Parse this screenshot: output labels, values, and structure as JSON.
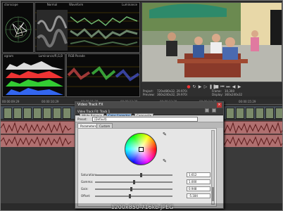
{
  "scopes": {
    "vectorscope": {
      "title": "ctorscope"
    },
    "waveform": {
      "title": "Waveform",
      "mode": "Normal",
      "mode2": "Luminance"
    },
    "histogram": {
      "title": "ogram",
      "mode": "Luminance/R,G,B"
    },
    "parade": {
      "title": "RGB Parade"
    }
  },
  "preview": {
    "project_label": "Project:",
    "project_value": "720x480x32, 29.970i",
    "preview_label": "Preview:",
    "preview_value": "360x240x32, 29.970i",
    "frame_label": "Frame:",
    "frame_value": "10,300",
    "display_label": "Display:",
    "display_value": "360x240x32"
  },
  "timeline": {
    "ruler": [
      "00:00:09:29",
      "00:00:10:29",
      "00:00:11:29",
      "00:00:12:29",
      "00:00:13:29",
      "00:00:14:29",
      "00:00:15:29"
    ]
  },
  "dialog": {
    "title": "Video Track FX",
    "close": "×",
    "chain_label": "Video Track FX: Track 1",
    "fx_buttons": [
      "White Balance",
      "Color Corrector",
      "Composite"
    ],
    "preset_label": "Preset:",
    "preset_value": "(Default)",
    "tabs": [
      "Parameters",
      "Custom"
    ],
    "params": [
      {
        "label": "Saturation:",
        "value": "1.612",
        "level": 0.6
      },
      {
        "label": "Gamma:",
        "value": "1.000",
        "level": 0.5
      },
      {
        "label": "Gain:",
        "value": "0.948",
        "level": 0.47
      },
      {
        "label": "Offset:",
        "value": "-5.184",
        "level": 0.45
      }
    ]
  },
  "caption": "1200x850  716kb  JPEG",
  "colors": {
    "accent": "#8fb5df",
    "audio": "#b07070",
    "close": "#b33333"
  }
}
